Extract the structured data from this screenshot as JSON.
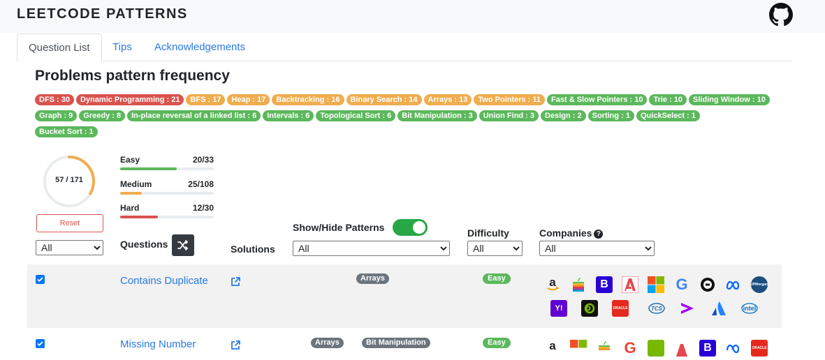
{
  "header": {
    "brand": "LEETCODE PATTERNS",
    "github_icon": "github-icon"
  },
  "tabs": [
    "Question List",
    "Tips",
    "Acknowledgements"
  ],
  "active_tab": 0,
  "section_title": "Problems pattern frequency",
  "pattern_badges": [
    [
      {
        "label": "DFS : 30",
        "color": "red"
      },
      {
        "label": "Dynamic Programming : 21",
        "color": "red"
      },
      {
        "label": "BFS : 17",
        "color": "orange"
      },
      {
        "label": "Heap : 17",
        "color": "orange"
      },
      {
        "label": "Backtracking : 16",
        "color": "orange"
      },
      {
        "label": "Binary Search : 14",
        "color": "orange"
      },
      {
        "label": "Arrays : 13",
        "color": "orange"
      },
      {
        "label": "Two Pointers : 11",
        "color": "orange"
      },
      {
        "label": "Fast & Slow Pointers : 10",
        "color": "green"
      },
      {
        "label": "Trie : 10",
        "color": "green"
      },
      {
        "label": "Sliding Window : 10",
        "color": "green"
      }
    ],
    [
      {
        "label": "Graph : 9",
        "color": "green"
      },
      {
        "label": "Greedy : 8",
        "color": "green"
      },
      {
        "label": "In-place reversal of a linked list : 6",
        "color": "green"
      },
      {
        "label": "Intervals : 6",
        "color": "green"
      },
      {
        "label": "Topological Sort : 6",
        "color": "green"
      },
      {
        "label": "Bit Manipulation : 3",
        "color": "green"
      },
      {
        "label": "Union Find : 3",
        "color": "green"
      },
      {
        "label": "Design : 2",
        "color": "green"
      },
      {
        "label": "Sorting : 1",
        "color": "green"
      },
      {
        "label": "QuickSelect : 1",
        "color": "green"
      }
    ],
    [
      {
        "label": "Bucket Sort : 1",
        "color": "green"
      }
    ]
  ],
  "colors": {
    "red": "#d9534f",
    "orange": "#f0ad4e",
    "green": "#5cb85c",
    "link": "#2a7ae2",
    "toggle": "#28a745"
  },
  "progress": {
    "total_label": "57 / 171",
    "fraction": 0.333,
    "levels": [
      {
        "label": "Easy",
        "count": "20/33",
        "fraction": 0.606,
        "color": "#5cb85c"
      },
      {
        "label": "Medium",
        "count": "25/108",
        "fraction": 0.231,
        "color": "#f0ad4e"
      },
      {
        "label": "Hard",
        "count": "12/30",
        "fraction": 0.4,
        "color": "#d9534f"
      }
    ]
  },
  "reset_label": "Reset",
  "filters": {
    "checked_select": "All",
    "questions_header": "Questions",
    "solutions_header": "Solutions",
    "patterns_header": "Show/Hide Patterns",
    "patterns_select": "All",
    "difficulty_header": "Difficulty",
    "difficulty_select": "All",
    "companies_header": "Companies",
    "companies_select": "All",
    "help_glyph": "?"
  },
  "rows": [
    {
      "checked": true,
      "name": "Contains Duplicate",
      "patterns": [
        "Arrays"
      ],
      "difficulty": "Easy",
      "companies": [
        "amazon",
        "apple",
        "bloomberg",
        "adobe",
        "microsoft",
        "google",
        "uber",
        "meta",
        "jpmorgan",
        "yahoo",
        "nvidia",
        "oracle",
        "tcs",
        "accenture",
        "atlassian",
        "intel"
      ]
    },
    {
      "checked": true,
      "name": "Missing Number",
      "patterns": [
        "Arrays",
        "Bit Manipulation"
      ],
      "difficulty": "Easy",
      "companies": [
        "amazon",
        "microsoft",
        "apple",
        "google",
        "nvidia",
        "adobe",
        "bloomberg",
        "meta",
        "oracle"
      ]
    }
  ],
  "company_text": {
    "bloomberg": "B",
    "google": "G",
    "jpmorgan": "JPMorgan",
    "yahoo": "Y!",
    "oracle": "ORACLE",
    "tcs": "TCS",
    "intel": "intel"
  }
}
